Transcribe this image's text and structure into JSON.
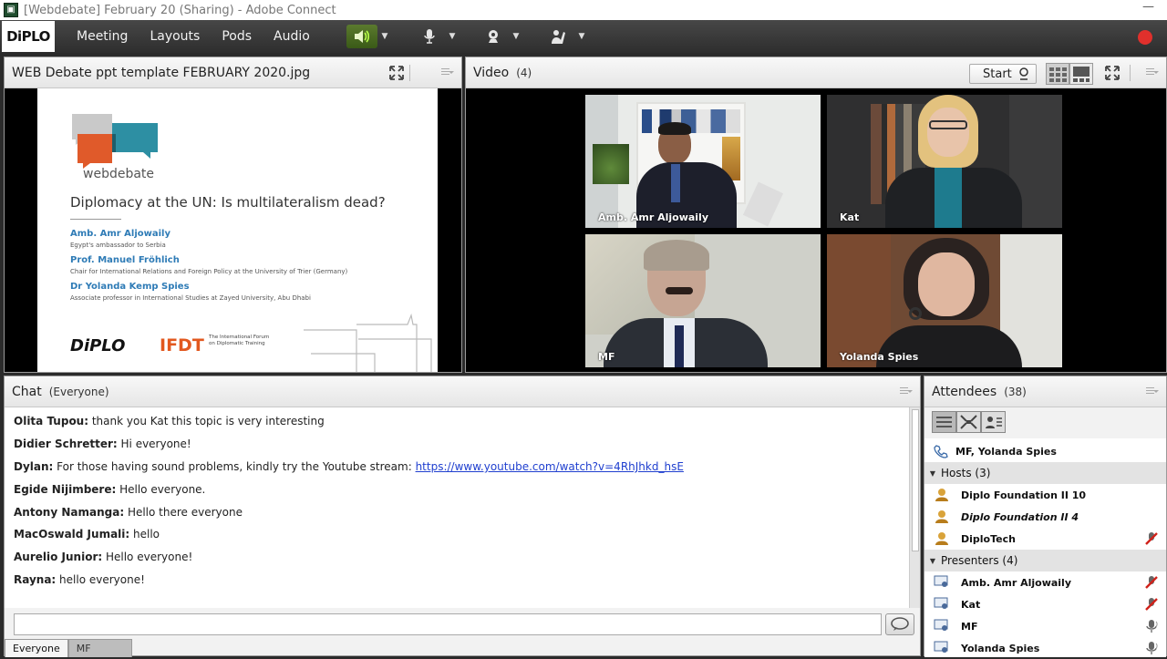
{
  "window": {
    "title": "[Webdebate] February 20 (Sharing) - Adobe Connect",
    "app_icon": "adobe-connect-icon"
  },
  "menubar": {
    "logo": "DiPLO",
    "items": [
      "Meeting",
      "Layouts",
      "Pods",
      "Audio"
    ],
    "speaker_active": true,
    "icons": [
      "speaker-icon",
      "microphone-icon",
      "webcam-icon",
      "raise-hand-icon"
    ],
    "record_color": "#e0302c"
  },
  "share_pod": {
    "title": "WEB Debate ppt template FEBRUARY 2020.jpg",
    "slide": {
      "brand": "webdebate",
      "title": "Diplomacy at the UN: Is multilateralism dead?",
      "speakers": [
        {
          "name": "Amb. Amr Aljowaily",
          "role": "Egypt's ambassador to Serbia"
        },
        {
          "name": "Prof. Manuel Fröhlich",
          "role": "Chair for International Relations and Foreign Policy at the University of Trier (Germany)"
        },
        {
          "name": "Dr Yolanda Kemp Spies",
          "role": "Associate professor in International Studies at Zayed University, Abu Dhabi"
        }
      ],
      "footer_logo_1": "DiPLO",
      "footer_logo_2": "IFDT",
      "footer_logo_2_sub": "The International Forum on Diplomatic Training"
    }
  },
  "video_pod": {
    "title": "Video",
    "count": "(4)",
    "start_label": "Start",
    "tiles": [
      {
        "name": "Amb. Amr Aljowaily"
      },
      {
        "name": "Kat"
      },
      {
        "name": "MF"
      },
      {
        "name": "Yolanda Spies"
      }
    ]
  },
  "chat_pod": {
    "title": "Chat",
    "scope": "(Everyone)",
    "messages": [
      {
        "user": "Olita Tupou:",
        "text": " thank you Kat this topic is very interesting"
      },
      {
        "user": "Didier Schretter:",
        "text": " Hi everyone!"
      },
      {
        "user": "Dylan:",
        "text": " For those having sound problems, kindly try the Youtube stream: ",
        "link": "https://www.youtube.com/watch?v=4RhJhkd_hsE"
      },
      {
        "user": "Egide Nijimbere:",
        "text": " Hello everyone."
      },
      {
        "user": "Antony Namanga:",
        "text": " Hello there everyone"
      },
      {
        "user": "MacOswald Jumali:",
        "text": " hello"
      },
      {
        "user": "Aurelio Junior:",
        "text": " Hello everyone!"
      },
      {
        "user": "Rayna:",
        "text": " hello everyone!"
      }
    ],
    "input_placeholder": "",
    "tabs": [
      "Everyone",
      "MF"
    ]
  },
  "attendees_pod": {
    "title": "Attendees",
    "count": "(38)",
    "speaking_now": "MF, Yolanda Spies",
    "groups": [
      {
        "label": "Hosts (3)",
        "members": [
          {
            "name": "Diplo Foundation II 10",
            "italic": false,
            "mic_off": false
          },
          {
            "name": "Diplo Foundation II 4",
            "italic": true,
            "mic_off": false
          },
          {
            "name": "DiploTech",
            "italic": false,
            "mic_off": true
          }
        ]
      },
      {
        "label": "Presenters (4)",
        "members": [
          {
            "name": "Amb. Amr Aljowaily",
            "mic_off": true
          },
          {
            "name": "Kat",
            "mic_off": true
          },
          {
            "name": "MF",
            "mic_off": false
          },
          {
            "name": "Yolanda Spies",
            "mic_off": false
          }
        ]
      }
    ]
  }
}
